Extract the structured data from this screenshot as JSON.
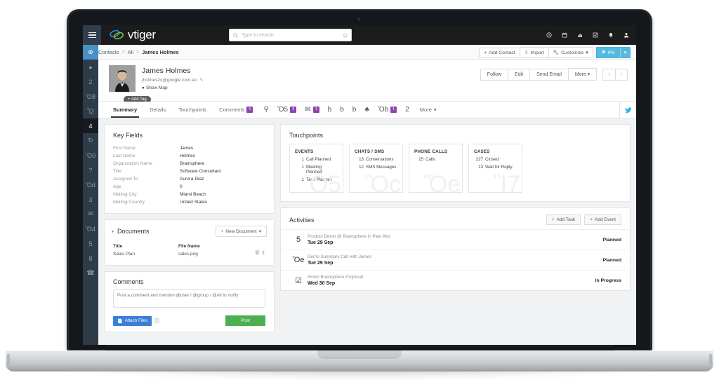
{
  "app": {
    "brand": "vtiger",
    "hamburger_icon": "hamburger-menu-icon"
  },
  "search": {
    "placeholder": "Type to search",
    "search_icon": "search-icon",
    "settings_icon": "search-settings-icon"
  },
  "top_icons": [
    {
      "name": "clock-icon",
      "glyph": "◔"
    },
    {
      "name": "calendar-icon",
      "glyph": "Ὄ5"
    },
    {
      "name": "analytics-icon",
      "glyph": "Ὄa"
    },
    {
      "name": "tasks-icon",
      "glyph": "☑"
    },
    {
      "name": "notifications-bell-icon",
      "glyph": "ὑ4"
    },
    {
      "name": "user-account-icon",
      "glyph": "὆4"
    }
  ],
  "breadcrumb": {
    "items": [
      "Contacts",
      "All",
      "James Holmes"
    ],
    "separator": ">"
  },
  "crumb_actions": {
    "add_contact": "Add Contact",
    "import": "Import",
    "customize": "Customize",
    "progress": "0%"
  },
  "rail": [
    {
      "name": "sidebar-item-globe",
      "glyph": "⊕",
      "state": "selected-blue"
    },
    {
      "name": "sidebar-item-sphere",
      "glyph": "●",
      "state": "normal"
    },
    {
      "name": "sidebar-item-campaigns",
      "glyph": "὎2",
      "state": "normal"
    },
    {
      "name": "sidebar-item-analytics",
      "glyph": "Ὄ8",
      "state": "normal"
    },
    {
      "name": "sidebar-item-organizations",
      "glyph": "Ἶ2",
      "state": "normal"
    },
    {
      "name": "sidebar-item-contacts",
      "glyph": "὆4",
      "state": "selected-dark"
    },
    {
      "name": "sidebar-item-sync",
      "glyph": "↻",
      "state": "normal"
    },
    {
      "name": "sidebar-item-deals",
      "glyph": "Ὃ0",
      "state": "normal"
    },
    {
      "name": "sidebar-item-help",
      "glyph": "?",
      "state": "normal"
    },
    {
      "name": "sidebar-item-notes",
      "glyph": "Ὅd",
      "state": "normal"
    },
    {
      "name": "sidebar-item-products",
      "glyph": "὜3",
      "state": "normal"
    },
    {
      "name": "sidebar-item-email",
      "glyph": "✉",
      "state": "normal"
    },
    {
      "name": "sidebar-item-documents",
      "glyph": "Ὄ4",
      "state": "normal"
    },
    {
      "name": "sidebar-item-inbox",
      "glyph": "὎5",
      "state": "normal"
    },
    {
      "name": "sidebar-item-print",
      "glyph": "὚8",
      "state": "normal"
    },
    {
      "name": "sidebar-item-phone",
      "glyph": "☎",
      "state": "normal"
    }
  ],
  "profile": {
    "name": "James Holmes",
    "email": "jholmes2c@google.com.au",
    "edit_icon": "edit-pencil-icon",
    "show_map": "Show Map",
    "map_pin_icon": "map-pin-icon",
    "add_tag": "Add Tag",
    "actions": [
      "Follow",
      "Edit",
      "Send Email",
      "More"
    ],
    "prev_icon": "‹",
    "next_icon": "›"
  },
  "tabs": [
    {
      "label": "Summary",
      "badge": "",
      "active": true,
      "name": "tab-summary"
    },
    {
      "label": "Details",
      "badge": "",
      "active": false,
      "name": "tab-details"
    },
    {
      "label": "Touchpoints",
      "badge": "",
      "active": false,
      "name": "tab-touchpoints"
    },
    {
      "label": "Comments",
      "badge": "1",
      "active": false,
      "name": "tab-comments"
    }
  ],
  "icon_tabs": [
    {
      "name": "tab-opportunity-icon",
      "glyph": "⚲",
      "badge": ""
    },
    {
      "name": "tab-events-calendar-icon",
      "glyph": "Ὄ5",
      "badge": "3"
    },
    {
      "name": "tab-emails-icon",
      "glyph": "✉",
      "badge": "1"
    },
    {
      "name": "tab-quotes-icon",
      "glyph": "὜b",
      "badge": ""
    },
    {
      "name": "tab-purchase-order-icon",
      "glyph": "὜b",
      "badge": ""
    },
    {
      "name": "tab-sales-order-icon",
      "glyph": "὜b",
      "badge": ""
    },
    {
      "name": "tab-projects-icon",
      "glyph": "♣",
      "badge": ""
    },
    {
      "name": "tab-invoices-icon",
      "glyph": "Ὄb",
      "badge": "1"
    },
    {
      "name": "tab-campaigns-icon",
      "glyph": "὎2",
      "badge": ""
    }
  ],
  "tabs_more": "More",
  "twitter_icon": "twitter-bird-icon",
  "key_fields": {
    "title": "Key Fields",
    "rows": [
      {
        "label": "First Name",
        "value": "James"
      },
      {
        "label": "Last Name",
        "value": "Holmes"
      },
      {
        "label": "Organization Name",
        "value": "Brainsphere"
      },
      {
        "label": "Title",
        "value": "Software Consultant"
      },
      {
        "label": "Assigned To",
        "value": "Aurora Diaz"
      },
      {
        "label": "Age",
        "value": "0"
      },
      {
        "label": "Mailing City",
        "value": "Miami Beach"
      },
      {
        "label": "Mailing Country",
        "value": "United States"
      }
    ]
  },
  "documents": {
    "title": "Documents",
    "new_button": "New Document",
    "columns": [
      "Title",
      "File Name"
    ],
    "rows": [
      {
        "title": "Sales Plan",
        "file_name": "sales.png"
      }
    ],
    "preview_icon": "image-preview-icon",
    "download_icon": "download-icon"
  },
  "comments": {
    "title": "Comments",
    "placeholder": "Post a comment and mention @user / @group / @All to notify",
    "attach_label": "Attach Files",
    "attach_icon": "attach-file-icon",
    "info_icon": "info-icon",
    "post_label": "Post"
  },
  "touchpoints": {
    "title": "Touchpoints",
    "cards": [
      {
        "header": "EVENTS",
        "ghost_icon": "calendar-ghost-icon",
        "lines": [
          {
            "count": "1",
            "label": "Call Planned"
          },
          {
            "count": "1",
            "label": "Meeting Planned"
          },
          {
            "count": "1",
            "label": "Task Planned"
          }
        ]
      },
      {
        "header": "CHATS / SMS",
        "ghost_icon": "chat-bubbles-ghost-icon",
        "lines": [
          {
            "count": "13",
            "label": "Conversations"
          },
          {
            "count": "12",
            "label": "SMS Messages"
          }
        ]
      },
      {
        "header": "PHONE CALLS",
        "ghost_icon": "phone-ghost-icon",
        "lines": [
          {
            "count": "15",
            "label": "Calls"
          }
        ]
      },
      {
        "header": "CASES",
        "ghost_icon": "headset-ghost-icon",
        "lines": [
          {
            "count": "227",
            "label": "Closed"
          },
          {
            "count": "13",
            "label": "Wait for Reply"
          }
        ]
      }
    ]
  },
  "activities": {
    "title": "Activities",
    "add_task": "Add Task",
    "add_event": "Add Event",
    "rows": [
      {
        "icon": "meeting-presentation-icon",
        "glyph": "὆5",
        "subject": "Product Demo @ Brainsphere in Palo Alto",
        "date": "Tue 29 Sep",
        "status": "Planned"
      },
      {
        "icon": "phone-call-icon",
        "glyph": "Ὅe",
        "subject": "Demo Summary Call with James",
        "date": "Tue 29 Sep",
        "status": "Planned"
      },
      {
        "icon": "task-checkbox-icon",
        "glyph": "☑",
        "subject": "Finish Brainsphere Proposal",
        "date": "Wed 30 Sep",
        "status": "In Progress"
      }
    ]
  },
  "colors": {
    "brand_blue": "#2a94d6",
    "brand_green": "#7ac143",
    "accent_blue": "#56b9e0",
    "badge_purple": "#8e44ad",
    "post_green": "#4caf50",
    "attach_blue": "#3b7dd8",
    "rail_bg": "#2e3b49"
  }
}
